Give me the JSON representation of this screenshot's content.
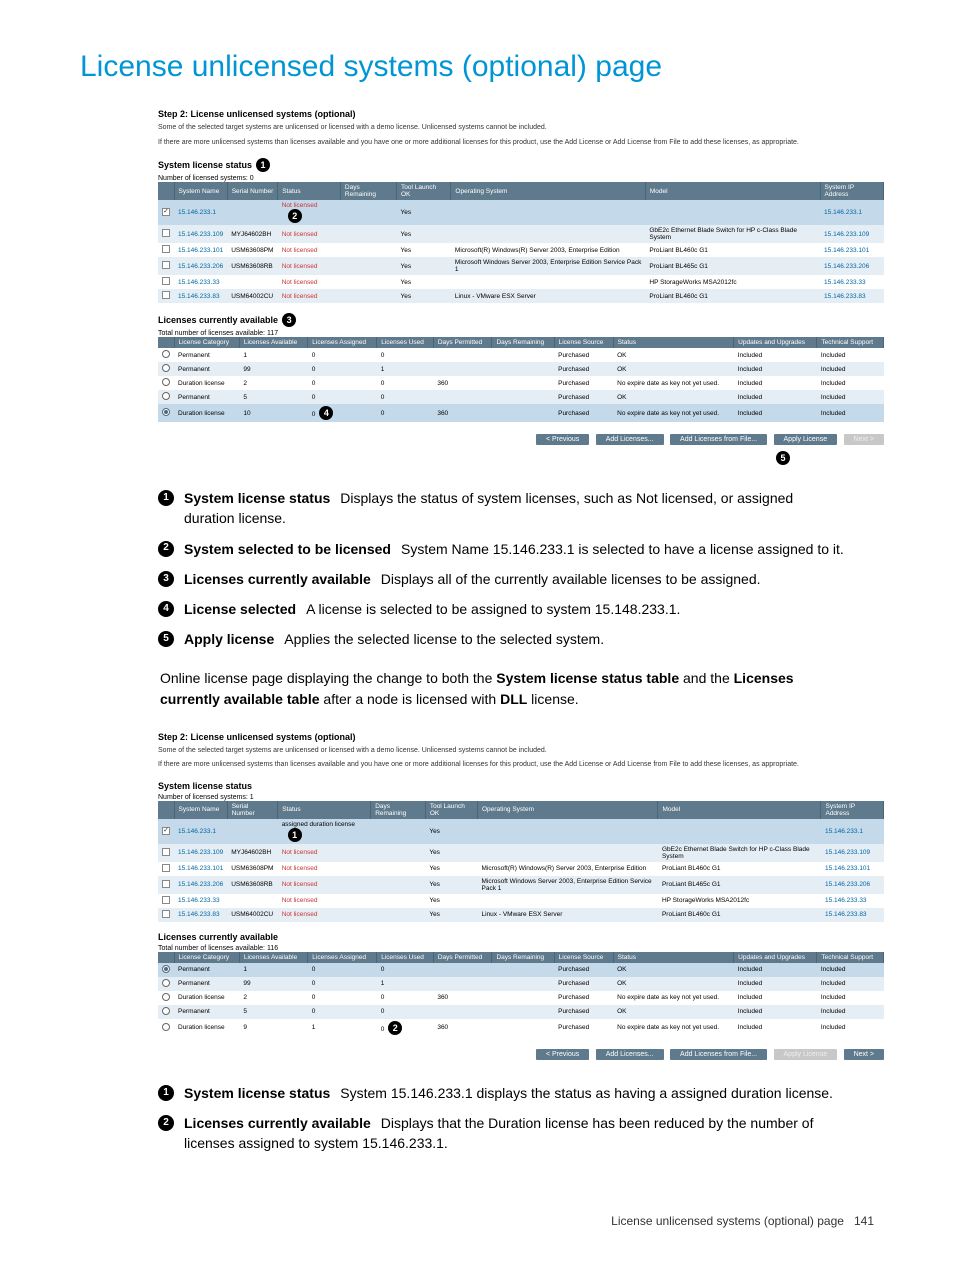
{
  "page_title": "License unlicensed systems (optional) page",
  "footer": {
    "label": "License unlicensed systems (optional) page",
    "page_number": "141"
  },
  "screenshot1": {
    "step_title": "Step 2: License unlicensed systems (optional)",
    "desc_line1": "Some of the selected target systems are unlicensed or licensed with a demo license. Unlicensed systems cannot be included.",
    "desc_line2": "If there are more unlicensed systems than licenses available and you have one or more additional licenses for this product, use the Add License or Add License from File to add these licenses, as appropriate.",
    "status_section_label": "System license status",
    "licensed_count_label": "Number of licensed systems: 0",
    "status_table": {
      "headers": [
        "",
        "System Name",
        "Serial Number",
        "Status",
        "Days Remaining",
        "Tool Launch OK",
        "Operating System",
        "Model",
        "System IP Address"
      ],
      "rows": [
        {
          "sel": true,
          "name": "15.146.233.1",
          "serial": "",
          "status": "Not licensed",
          "days": "",
          "ok": "Yes",
          "os": "",
          "model": "",
          "ip": "15.146.233.1"
        },
        {
          "sel": false,
          "name": "15.146.233.109",
          "serial": "MYJ64602BH",
          "status": "Not licensed",
          "days": "",
          "ok": "Yes",
          "os": "",
          "model": "GbE2c Ethernet Blade Switch for HP c-Class Blade System",
          "ip": "15.146.233.109"
        },
        {
          "sel": false,
          "name": "15.146.233.101",
          "serial": "USM63608PM",
          "status": "Not licensed",
          "days": "",
          "ok": "Yes",
          "os": "Microsoft(R) Windows(R) Server 2003, Enterprise Edition",
          "model": "ProLiant BL460c G1",
          "ip": "15.146.233.101"
        },
        {
          "sel": false,
          "name": "15.146.233.206",
          "serial": "USM63608RB",
          "status": "Not licensed",
          "days": "",
          "ok": "Yes",
          "os": "Microsoft Windows Server 2003, Enterprise Edition Service Pack 1",
          "model": "ProLiant BL465c G1",
          "ip": "15.146.233.206"
        },
        {
          "sel": false,
          "name": "15.146.233.33",
          "serial": "",
          "status": "Not licensed",
          "days": "",
          "ok": "Yes",
          "os": "",
          "model": "HP StorageWorks MSA2012fc",
          "ip": "15.146.233.33"
        },
        {
          "sel": false,
          "name": "15.146.233.83",
          "serial": "USM64002CU",
          "status": "Not licensed",
          "days": "",
          "ok": "Yes",
          "os": "Linux - VMware ESX Server",
          "model": "ProLiant BL460c G1",
          "ip": "15.146.233.83"
        }
      ]
    },
    "avail_section_label": "Licenses currently available",
    "total_licenses_label": "Total number of licenses available: 117",
    "avail_table": {
      "headers": [
        "",
        "License Category",
        "Licenses Available",
        "Licenses Assigned",
        "Licenses Used",
        "Days Permitted",
        "Days Remaining",
        "License Source",
        "Status",
        "Updates and Upgrades",
        "Technical Support"
      ],
      "rows": [
        {
          "sel": false,
          "cat": "Permanent",
          "avail": "1",
          "asg": "0",
          "used": "0",
          "dp": "",
          "dr": "",
          "src": "Purchased",
          "status": "OK",
          "uu": "Included",
          "ts": "Included"
        },
        {
          "sel": false,
          "cat": "Permanent",
          "avail": "99",
          "asg": "0",
          "used": "1",
          "dp": "",
          "dr": "",
          "src": "Purchased",
          "status": "OK",
          "uu": "Included",
          "ts": "Included"
        },
        {
          "sel": false,
          "cat": "Duration license",
          "avail": "2",
          "asg": "0",
          "used": "0",
          "dp": "360",
          "dr": "",
          "src": "Purchased",
          "status": "No expire date as key not yet used.",
          "uu": "Included",
          "ts": "Included"
        },
        {
          "sel": false,
          "cat": "Permanent",
          "avail": "5",
          "asg": "0",
          "used": "0",
          "dp": "",
          "dr": "",
          "src": "Purchased",
          "status": "OK",
          "uu": "Included",
          "ts": "Included"
        },
        {
          "sel": true,
          "cat": "Duration license",
          "avail": "10",
          "asg": "0",
          "used": "0",
          "dp": "360",
          "dr": "",
          "src": "Purchased",
          "status": "No expire date as key not yet used.",
          "uu": "Included",
          "ts": "Included"
        }
      ]
    },
    "buttons": {
      "prev": "< Previous",
      "add": "Add Licenses...",
      "add_file": "Add Licenses from File...",
      "apply": "Apply License",
      "next": "Next >"
    }
  },
  "callouts1": [
    {
      "n": "1",
      "term": "System license status",
      "desc": "Displays the status of system licenses, such as Not licensed, or assigned duration license."
    },
    {
      "n": "2",
      "term": "System selected to be licensed",
      "desc": "System Name 15.146.233.1 is selected to have a license assigned to it."
    },
    {
      "n": "3",
      "term": "Licenses currently available",
      "desc": "Displays all of the currently available licenses to be assigned."
    },
    {
      "n": "4",
      "term": "License selected",
      "desc": "A license is selected to be assigned to system 15.148.233.1."
    },
    {
      "n": "5",
      "term": "Apply license",
      "desc": "Applies the selected license to the selected system."
    }
  ],
  "between_text": {
    "pre": "Online license page displaying the change to both the ",
    "b1": "System license status table",
    "mid": " and the ",
    "b2": "Licenses currently available table",
    "post": " after a node is licensed with ",
    "b3": "DLL",
    "tail": " license."
  },
  "screenshot2": {
    "step_title": "Step 2: License unlicensed systems (optional)",
    "desc_line1": "Some of the selected target systems are unlicensed or licensed with a demo license. Unlicensed systems cannot be included.",
    "desc_line2": "If there are more unlicensed systems than licenses available and you have one or more additional licenses for this product, use the Add License or Add License from File to add these licenses, as appropriate.",
    "status_section_label": "System license status",
    "licensed_count_label": "Number of licensed systems: 1",
    "status_table": {
      "headers": [
        "",
        "System Name",
        "Serial Number",
        "Status",
        "Days Remaining",
        "Tool Launch OK",
        "Operating System",
        "Model",
        "System IP Address"
      ],
      "rows": [
        {
          "sel": true,
          "name": "15.146.233.1",
          "serial": "",
          "status": "assigned duration license",
          "status_red": false,
          "days": "",
          "ok": "Yes",
          "os": "",
          "model": "",
          "ip": "15.146.233.1"
        },
        {
          "sel": false,
          "name": "15.146.233.109",
          "serial": "MYJ64602BH",
          "status": "Not licensed",
          "status_red": true,
          "days": "",
          "ok": "Yes",
          "os": "",
          "model": "GbE2c Ethernet Blade Switch for HP c-Class Blade System",
          "ip": "15.146.233.109"
        },
        {
          "sel": false,
          "name": "15.146.233.101",
          "serial": "USM63608PM",
          "status": "Not licensed",
          "status_red": true,
          "days": "",
          "ok": "Yes",
          "os": "Microsoft(R) Windows(R) Server 2003, Enterprise Edition",
          "model": "ProLiant BL460c G1",
          "ip": "15.146.233.101"
        },
        {
          "sel": false,
          "name": "15.146.233.206",
          "serial": "USM63608RB",
          "status": "Not licensed",
          "status_red": true,
          "days": "",
          "ok": "Yes",
          "os": "Microsoft Windows Server 2003, Enterprise Edition Service Pack 1",
          "model": "ProLiant BL465c G1",
          "ip": "15.146.233.206"
        },
        {
          "sel": false,
          "name": "15.146.233.33",
          "serial": "",
          "status": "Not licensed",
          "status_red": true,
          "days": "",
          "ok": "Yes",
          "os": "",
          "model": "HP StorageWorks MSA2012fc",
          "ip": "15.146.233.33"
        },
        {
          "sel": false,
          "name": "15.146.233.83",
          "serial": "USM64002CU",
          "status": "Not licensed",
          "status_red": true,
          "days": "",
          "ok": "Yes",
          "os": "Linux - VMware ESX Server",
          "model": "ProLiant BL460c G1",
          "ip": "15.146.233.83"
        }
      ]
    },
    "avail_section_label": "Licenses currently available",
    "total_licenses_label": "Total number of licenses available: 116",
    "avail_table": {
      "headers": [
        "",
        "License Category",
        "Licenses Available",
        "Licenses Assigned",
        "Licenses Used",
        "Days Permitted",
        "Days Remaining",
        "License Source",
        "Status",
        "Updates and Upgrades",
        "Technical Support"
      ],
      "rows": [
        {
          "sel": true,
          "cat": "Permanent",
          "avail": "1",
          "asg": "0",
          "used": "0",
          "dp": "",
          "dr": "",
          "src": "Purchased",
          "status": "OK",
          "uu": "Included",
          "ts": "Included"
        },
        {
          "sel": false,
          "cat": "Permanent",
          "avail": "99",
          "asg": "0",
          "used": "1",
          "dp": "",
          "dr": "",
          "src": "Purchased",
          "status": "OK",
          "uu": "Included",
          "ts": "Included"
        },
        {
          "sel": false,
          "cat": "Duration license",
          "avail": "2",
          "asg": "0",
          "used": "0",
          "dp": "360",
          "dr": "",
          "src": "Purchased",
          "status": "No expire date as key not yet used.",
          "uu": "Included",
          "ts": "Included"
        },
        {
          "sel": false,
          "cat": "Permanent",
          "avail": "5",
          "asg": "0",
          "used": "0",
          "dp": "",
          "dr": "",
          "src": "Purchased",
          "status": "OK",
          "uu": "Included",
          "ts": "Included"
        },
        {
          "sel": false,
          "cat": "Duration license",
          "avail": "9",
          "asg": "1",
          "used": "0",
          "dp": "360",
          "dr": "",
          "src": "Purchased",
          "status": "No expire date as key not yet used.",
          "uu": "Included",
          "ts": "Included"
        }
      ]
    },
    "buttons": {
      "prev": "< Previous",
      "add": "Add Licenses...",
      "add_file": "Add Licenses from File...",
      "apply": "Apply License",
      "next": "Next >"
    }
  },
  "callouts2": [
    {
      "n": "1",
      "term": "System license status",
      "desc": "System 15.146.233.1 displays the status as having a assigned duration license."
    },
    {
      "n": "2",
      "term": "Licenses currently available",
      "desc": "Displays that the Duration license has been reduced by the number of licenses assigned to system 15.146.233.1."
    }
  ]
}
